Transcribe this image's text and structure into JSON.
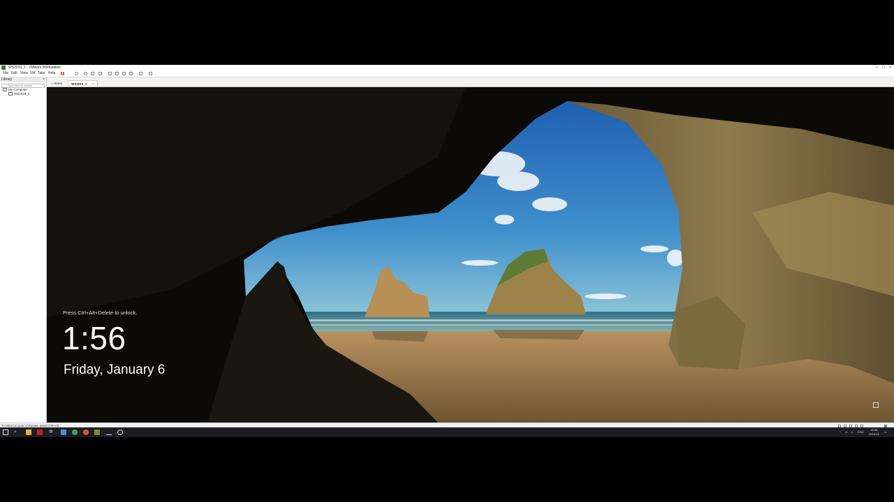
{
  "window": {
    "title": "WS2019_1 - VMware Workstation"
  },
  "menu": {
    "items": [
      "File",
      "Edit",
      "View",
      "VM",
      "Tabs",
      "Help"
    ]
  },
  "library": {
    "header": "Library",
    "close": "×",
    "search_placeholder": "Type here to search",
    "tree": [
      {
        "label": "My Computer",
        "level": 0
      },
      {
        "label": "WS2019_1",
        "level": 1
      }
    ]
  },
  "tabs": [
    {
      "label": "Home",
      "active": false
    },
    {
      "label": "WS2019_1",
      "active": true
    }
  ],
  "tab_close": "×",
  "lockscreen": {
    "hint": "Press Ctrl+Alt+Delete to unlock.",
    "time": "1:56",
    "date": "Friday, January 6"
  },
  "statusbar": {
    "text": "To return to your computer, press Ctrl+Alt."
  },
  "taskbar": {
    "language": "ENG",
    "time": "18:56",
    "date": "2023/1/6"
  },
  "window_controls": {
    "minimize": "–",
    "maximize": "□",
    "close": "×"
  }
}
